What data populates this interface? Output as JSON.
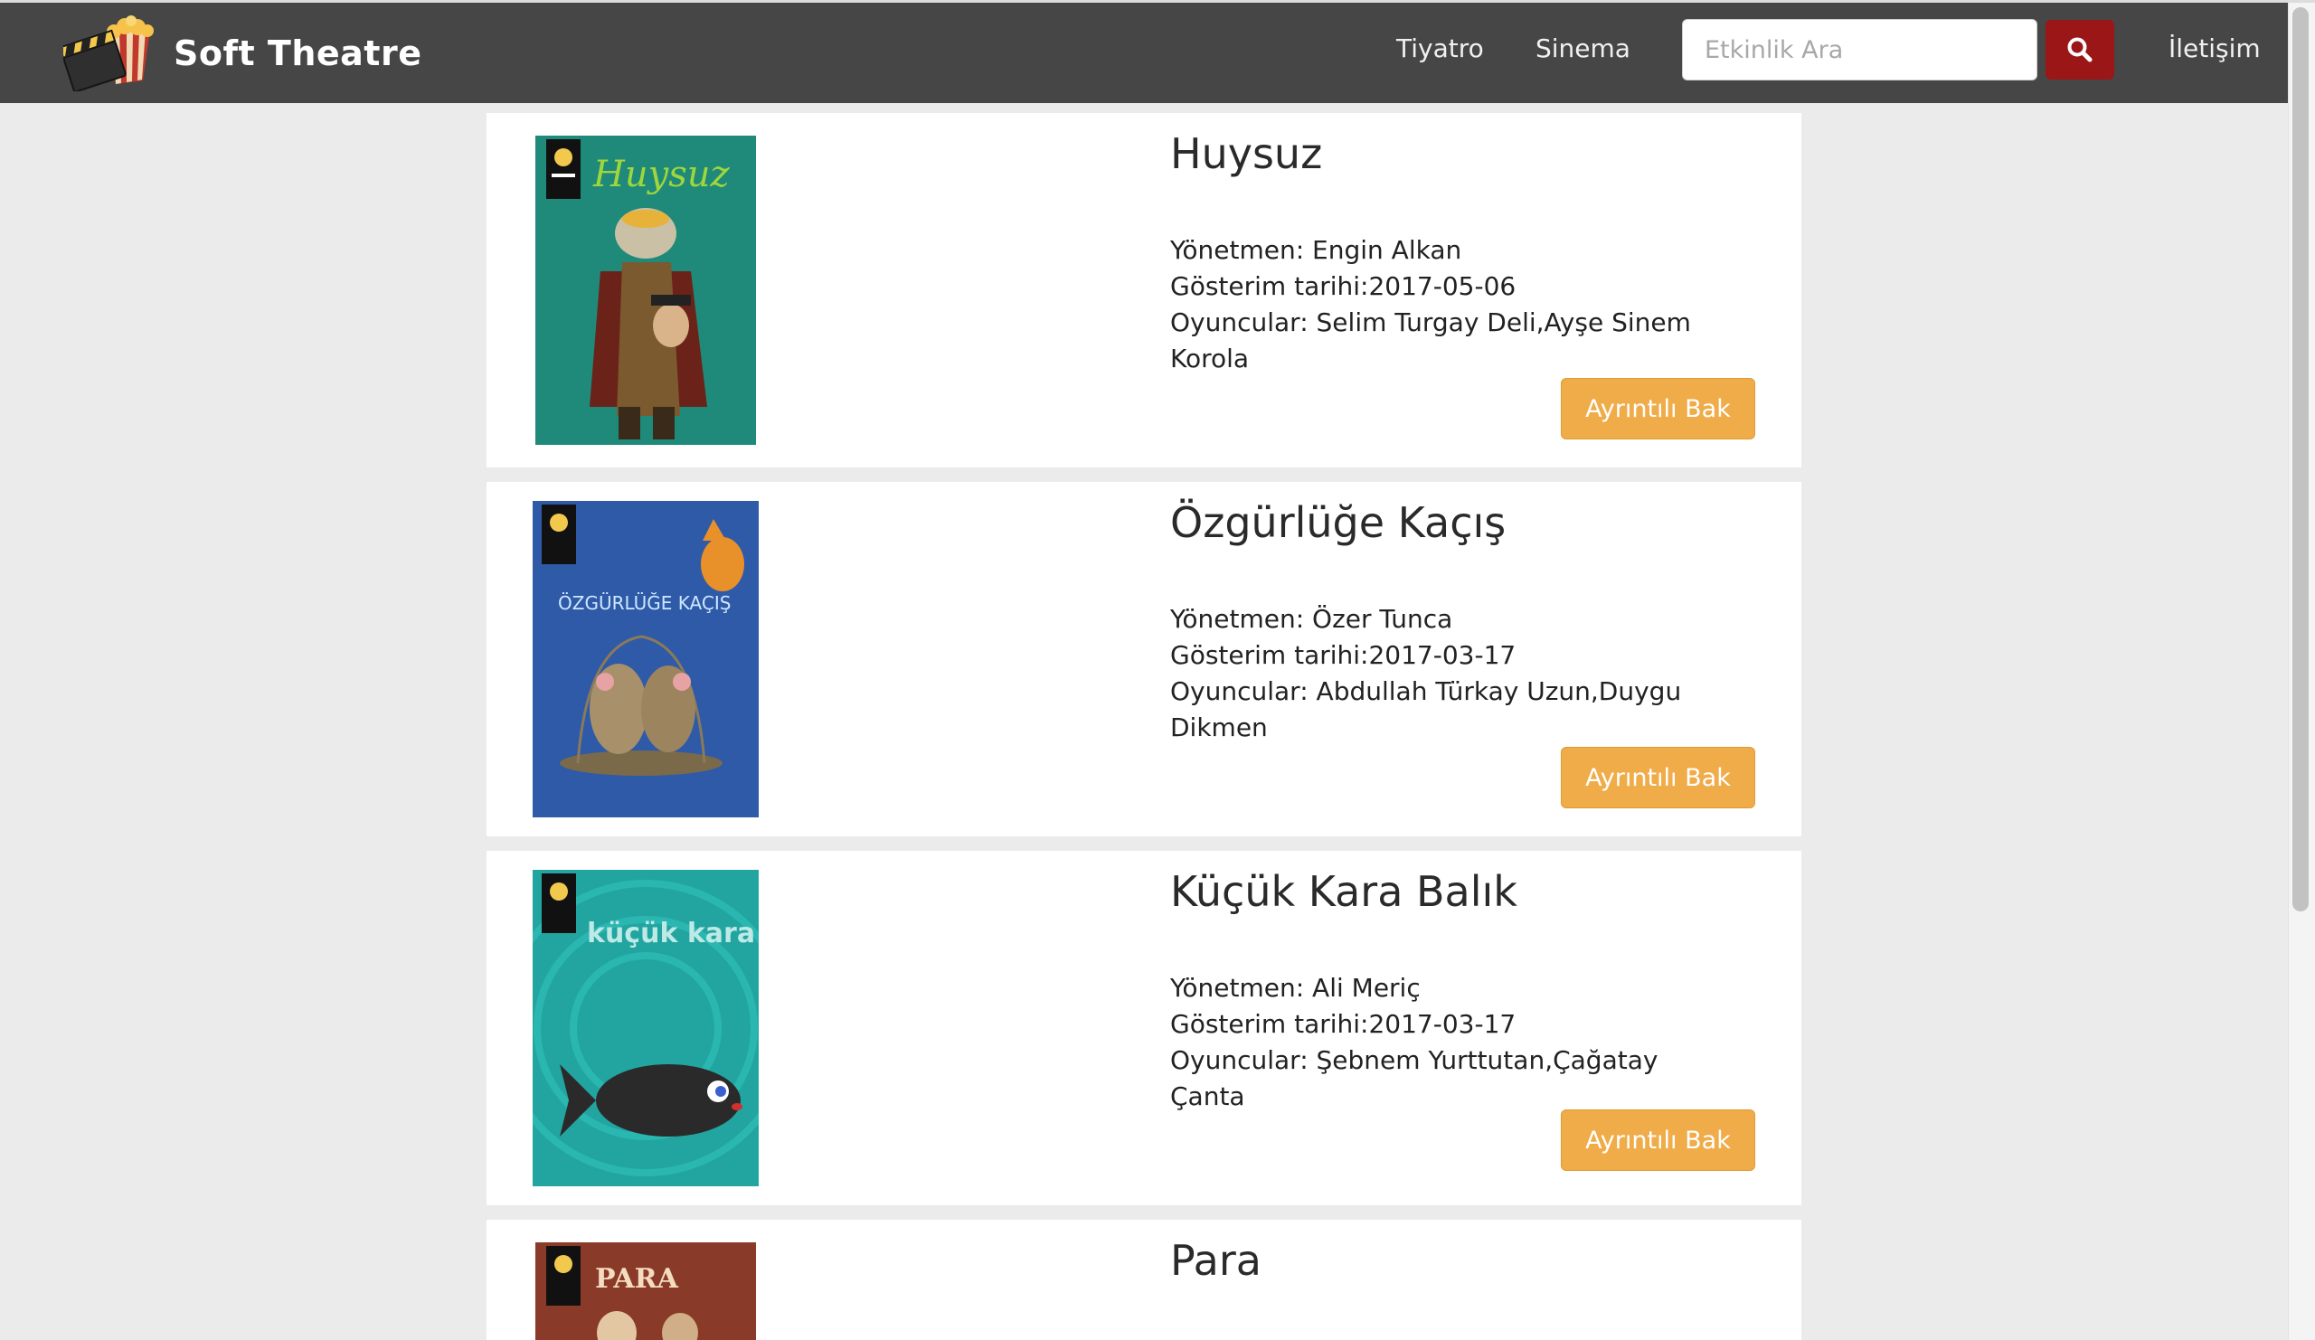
{
  "navbar": {
    "brand_name": "Soft Theatre",
    "links": [
      "Tiyatro",
      "Sinema"
    ],
    "search_placeholder": "Etkinlik Ara",
    "search_icon": "search-icon",
    "contact_label": "İletişim",
    "colors": {
      "background": "#464646",
      "search_button": "#9b1616",
      "detail_button": "#efac48"
    }
  },
  "events": [
    {
      "title": "Huysuz",
      "director": "Yönetmen: Engin Alkan",
      "date": "Gösterim tarihi:2017-05-06",
      "cast": "Oyuncular: Selim Turgay Deli,Ayşe Sinem Korola",
      "button": "Ayrıntılı Bak",
      "poster": {
        "text": "Huysuz",
        "color": "#1f8a7a"
      }
    },
    {
      "title": "Özgürlüğe Kaçış",
      "director": "Yönetmen: Özer Tunca",
      "date": "Gösterim tarihi:2017-03-17",
      "cast": "Oyuncular: Abdullah Türkay Uzun,Duygu Dikmen",
      "button": "Ayrıntılı Bak",
      "poster": {
        "text": "ÖZGÜRLÜĞE KAÇIŞ",
        "color": "#2e5aa8"
      }
    },
    {
      "title": "Küçük Kara Balık",
      "director": "Yönetmen: Ali Meriç",
      "date": "Gösterim tarihi:2017-03-17",
      "cast": "Oyuncular: Şebnem Yurttutan,Çağatay Çanta",
      "button": "Ayrıntılı Bak",
      "poster": {
        "text": "küçük kara balık",
        "color": "#22a5a0"
      }
    },
    {
      "title": "Para",
      "poster": {
        "text": "PARA",
        "color": "#8a3a28"
      }
    }
  ]
}
